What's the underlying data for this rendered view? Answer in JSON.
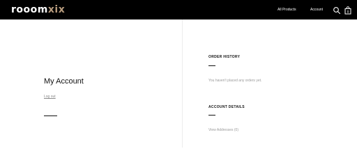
{
  "header": {
    "logo_part1": "rooom",
    "logo_part2": "xix",
    "nav": {
      "all_products": "All Products",
      "account": "Account"
    },
    "icons": [
      "search-icon",
      "shopping-bag-icon"
    ],
    "colors": {
      "bar": "#000000",
      "logo": "#ffffff",
      "logo_accent": "#b79b7d"
    }
  },
  "account": {
    "title": "My Account",
    "logout": "Log out"
  },
  "orders": {
    "heading": "ORDER HISTORY",
    "empty_message": "You haven't placed any orders yet."
  },
  "details": {
    "heading": "ACCOUNT DETAILS",
    "view_addresses": "View Addresses (0)"
  }
}
